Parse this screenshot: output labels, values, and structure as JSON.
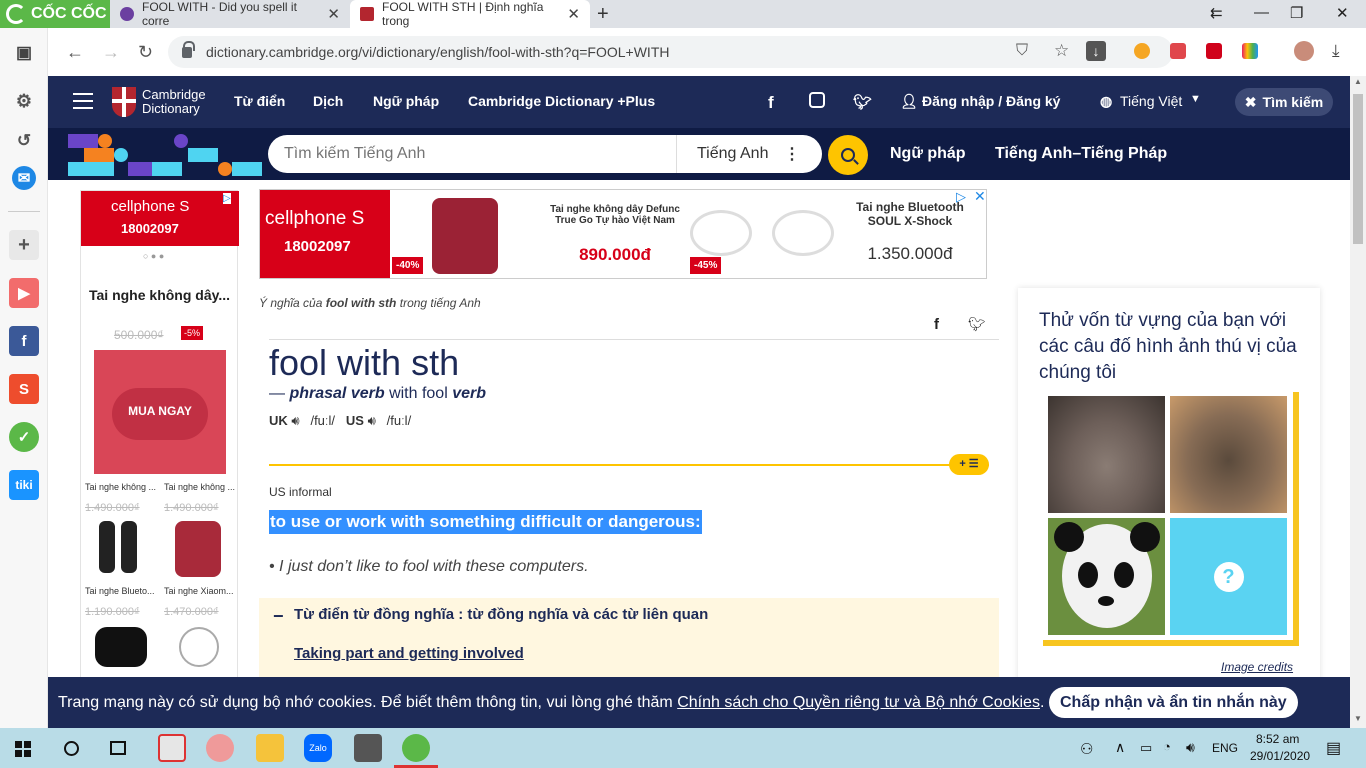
{
  "browser": {
    "brand": "CỐC CỐC",
    "tabs": [
      {
        "title": "FOOL WITH - Did you spell it corre"
      },
      {
        "title": "FOOL WITH STH | Định nghĩa trong"
      }
    ],
    "url": "dictionary.cambridge.org/vi/dictionary/english/fool-with-sth?q=FOOL+WITH",
    "window_controls": [
      "⇇",
      "—",
      "❐",
      "✕"
    ]
  },
  "site": {
    "logo": [
      "Cambridge",
      "Dictionary"
    ],
    "nav": [
      "Từ điển",
      "Dịch",
      "Ngữ pháp",
      "Cambridge Dictionary +Plus"
    ],
    "login": "Đăng nhập / Đăng ký",
    "language": "Tiếng Việt",
    "search_button": "Tìm kiếm",
    "search": {
      "placeholder": "Tìm kiếm Tiếng Anh",
      "lang": "Tiếng Anh"
    },
    "sublinks": [
      "Ngữ pháp",
      "Tiếng Anh–Tiếng Pháp"
    ]
  },
  "left_ad": {
    "brand": "cellphone S",
    "hotline": "18002097",
    "title": "Tai nghe không dây...",
    "old_price": "500.000₫",
    "discount": "-5%",
    "cta": "MUA NGAY",
    "items": [
      {
        "name": "Tai nghe không ...",
        "price": "1.490.000₫"
      },
      {
        "name": "Tai nghe không ...",
        "price": "1.490.000₫"
      },
      {
        "name": "Tai nghe Blueto...",
        "price": "1.190.000₫"
      },
      {
        "name": "Tai nghe Xiaom...",
        "price": "1.470.000₫"
      }
    ]
  },
  "top_ad": {
    "brand": "cellphone S",
    "hotline": "18002097",
    "p1": {
      "name": "Tai nghe không dây Defunc True Go Tự hào Việt Nam",
      "price": "890.000đ",
      "badge": "-40%"
    },
    "p2": {
      "name": "Tai nghe Bluetooth SOUL X-Shock",
      "price": "1.350.000đ",
      "badge": "-45%"
    }
  },
  "entry": {
    "origin_prefix": "Ý nghĩa của",
    "origin_word": "fool with sth",
    "origin_suffix": "trong tiếng Anh",
    "headword": "fool with sth",
    "pos_dash": "—",
    "pos": "phrasal verb",
    "pos_mid": "with fool",
    "pos_verb": "verb",
    "uk": "UK",
    "uk_ipa": "/fuːl/",
    "us": "US",
    "us_ipa": "/fuːl/",
    "badge": "+ ☰",
    "register": "US informal",
    "definition": "to use or work with something difficult or dangerous:",
    "example": "I just don’t like to fool with these computers.",
    "thesaurus_title": "Từ điển từ đồng nghĩa : từ đồng nghĩa và các từ liên quan",
    "thesaurus_link": "Taking part and getting involved"
  },
  "quiz": {
    "title": "Thử vốn từ vựng của bạn với các câu đố hình ảnh thú vị của chúng tôi",
    "credits": "Image credits"
  },
  "cookie": {
    "text": "Trang mạng này có sử dụng bộ nhớ cookies. Để biết thêm thông tin, vui lòng ghé thăm",
    "link": "Chính sách cho Quyền riêng tư và Bộ nhớ Cookies",
    "end": ".",
    "accept": "Chấp nhận và ẩn tin nhắn này"
  },
  "taskbar": {
    "lang": "ENG",
    "time": "8:52 am",
    "date": "29/01/2020"
  },
  "colors": {
    "navy": "#1d2a57",
    "yellow": "#fec400",
    "highlight": "#3390ff",
    "cellphones_red": "#d70018"
  }
}
